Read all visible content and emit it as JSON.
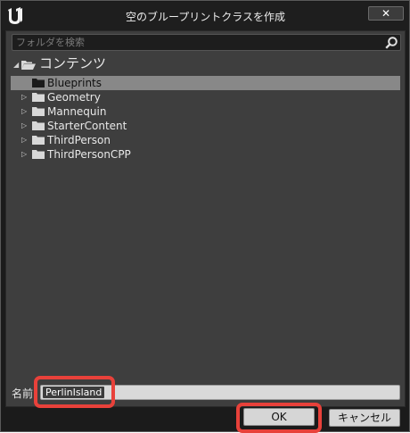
{
  "window": {
    "title": "空のブループリントクラスを作成",
    "close_label": "✕"
  },
  "search": {
    "placeholder": "フォルダを検索"
  },
  "tree": {
    "root": "コンテンツ",
    "items": [
      {
        "label": "Blueprints",
        "selected": true,
        "expandable": false
      },
      {
        "label": "Geometry",
        "selected": false,
        "expandable": true
      },
      {
        "label": "Mannequin",
        "selected": false,
        "expandable": true
      },
      {
        "label": "StarterContent",
        "selected": false,
        "expandable": true
      },
      {
        "label": "ThirdPerson",
        "selected": false,
        "expandable": true
      },
      {
        "label": "ThirdPersonCPP",
        "selected": false,
        "expandable": true
      }
    ]
  },
  "name": {
    "label": "名前",
    "value": "PerlinIsland"
  },
  "buttons": {
    "ok": "OK",
    "cancel": "キャンセル"
  },
  "colors": {
    "highlight": "#e8413a",
    "selection": "#888888",
    "panel": "#3e3e3e"
  }
}
